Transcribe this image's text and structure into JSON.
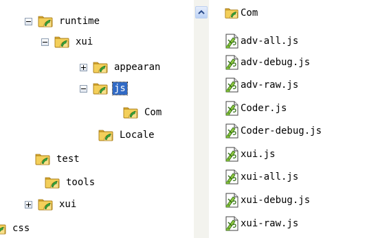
{
  "tree": {
    "nodes": [
      {
        "label": "runtime",
        "expander": "minus",
        "selected": false
      },
      {
        "label": "xui",
        "expander": "minus",
        "selected": false
      },
      {
        "label": "appearan",
        "expander": "plus",
        "selected": false
      },
      {
        "label": "js",
        "expander": "minus",
        "selected": true
      },
      {
        "label": "Com",
        "expander": "none",
        "selected": false
      },
      {
        "label": "Locale",
        "expander": "none",
        "selected": false
      },
      {
        "label": "test",
        "expander": "none",
        "selected": false
      },
      {
        "label": "tools",
        "expander": "none",
        "selected": false
      },
      {
        "label": "xui",
        "expander": "plus",
        "selected": false
      },
      {
        "label": "css",
        "expander": "none",
        "selected": false
      }
    ]
  },
  "scrollbar": {
    "up_icon": "chevron-up-icon"
  },
  "files": {
    "items": [
      {
        "name": "Com",
        "kind": "folder"
      },
      {
        "name": "adv-all.js",
        "kind": "js-file"
      },
      {
        "name": "adv-debug.js",
        "kind": "js-file"
      },
      {
        "name": "adv-raw.js",
        "kind": "js-file"
      },
      {
        "name": "Coder.js",
        "kind": "js-file"
      },
      {
        "name": "Coder-debug.js",
        "kind": "js-file"
      },
      {
        "name": "xui.js",
        "kind": "js-file"
      },
      {
        "name": "xui-all.js",
        "kind": "js-file"
      },
      {
        "name": "xui-debug.js",
        "kind": "js-file"
      },
      {
        "name": "xui-raw.js",
        "kind": "js-file"
      }
    ]
  },
  "colors": {
    "selection": "#316ac5",
    "folder": "#f2c94a",
    "folder_dark": "#c9951c",
    "folder_leaf": "#3aa53a"
  }
}
